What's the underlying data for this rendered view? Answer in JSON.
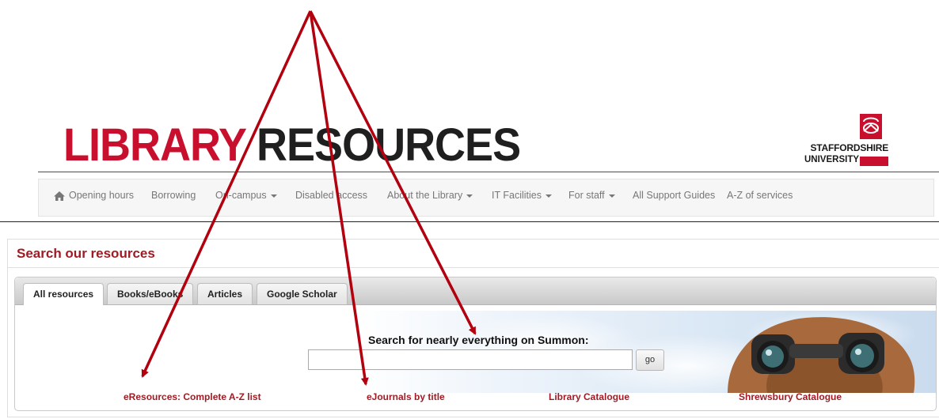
{
  "header": {
    "title_part1": "LIBRARY",
    "title_part2": "RESOURCES",
    "logo_line1": "STAFFORDSHIRE",
    "logo_line2": "UNIVERSITY"
  },
  "nav": {
    "home_icon": "home-icon",
    "items": [
      {
        "label": "Opening hours",
        "dropdown": false
      },
      {
        "label": "Borrowing",
        "dropdown": false
      },
      {
        "label": "On-campus",
        "dropdown": true
      },
      {
        "label": "Disabled access",
        "dropdown": false
      },
      {
        "label": "About the Library",
        "dropdown": true
      },
      {
        "label": "IT Facilities",
        "dropdown": true
      },
      {
        "label": "For staff",
        "dropdown": true
      },
      {
        "label": "All Support Guides",
        "dropdown": false
      },
      {
        "label": "A-Z of services",
        "dropdown": false
      }
    ]
  },
  "search": {
    "heading": "Search our resources",
    "tabs": [
      {
        "label": "All resources",
        "active": true
      },
      {
        "label": "Books/eBooks",
        "active": false
      },
      {
        "label": "Articles",
        "active": false
      },
      {
        "label": "Google Scholar",
        "active": false
      }
    ],
    "label": "Search for nearly everything on Summon:",
    "input_value": "",
    "go_label": "go"
  },
  "links": [
    "eResources: Complete A-Z list",
    "eJournals by title",
    "Library Catalogue",
    "Shrewsbury Catalogue"
  ],
  "colors": {
    "brand_red": "#c8102e",
    "link_red": "#a01c25",
    "annotation_arrow": "#b3000f"
  }
}
